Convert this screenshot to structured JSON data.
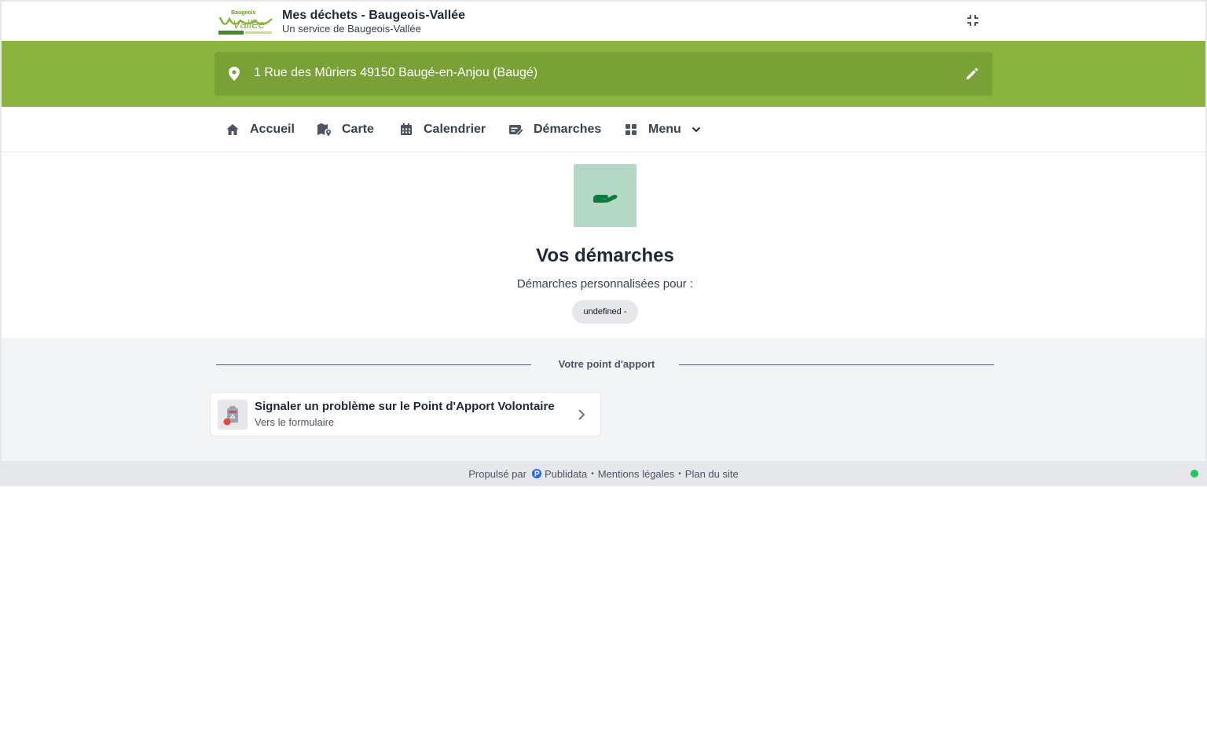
{
  "header": {
    "logo_alt": "Baugeois Vallée",
    "title": "Mes déchets - Baugeois-Vallée",
    "subtitle": "Un service de Baugeois-Vallée",
    "collapse_icon": "collapse-icon"
  },
  "address": {
    "text": "1 Rue des Mûriers 49150 Baugé-en-Anjou (Baugé)",
    "pin_icon": "map-pin-icon",
    "edit_icon": "pencil-icon"
  },
  "nav": {
    "items": [
      {
        "label": "Accueil",
        "icon": "home-icon"
      },
      {
        "label": "Carte",
        "icon": "map-icon"
      },
      {
        "label": "Calendrier",
        "icon": "calendar-icon"
      },
      {
        "label": "Démarches",
        "icon": "form-icon"
      },
      {
        "label": "Menu",
        "icon": "grid-icon"
      }
    ]
  },
  "main": {
    "hero_icon": "hand-icon",
    "title": "Vos démarches",
    "subtitle": "Démarches personnalisées pour :",
    "chip": "undefined -"
  },
  "section": {
    "heading": "Votre point d'apport",
    "cards": [
      {
        "title": "Signaler un problème sur le Point d'Apport Volontaire",
        "subtitle": "Vers le formulaire",
        "icon": "recycling-bin-icon"
      }
    ]
  },
  "footer": {
    "powered_by": "Propulsé par",
    "brand": "Publidata",
    "legal": "Mentions légales",
    "sitemap": "Plan du site",
    "separator": "•"
  },
  "colors": {
    "green_band": "#8ab33f",
    "address_bar": "#7aa136",
    "hero_bg": "#b3d9c6",
    "hero_icon": "#0f7a3d",
    "status": "#22c55e"
  }
}
